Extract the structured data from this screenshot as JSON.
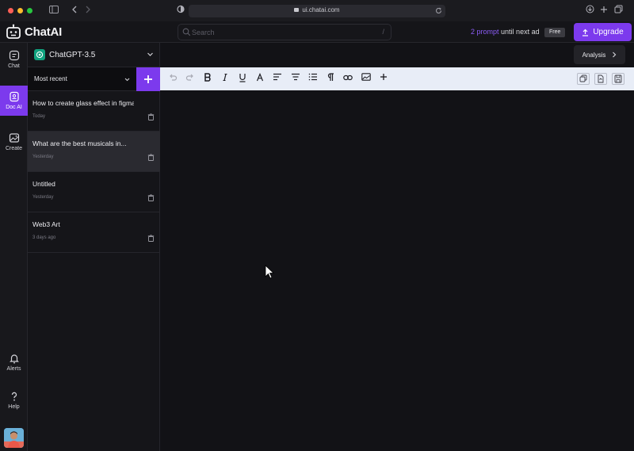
{
  "browser": {
    "url": "ui.chatai.com"
  },
  "app": {
    "name": "ChatAI",
    "search_placeholder": "Search",
    "search_shortcut": "/",
    "prompt_count": "2 prompt",
    "prompt_suffix": "until next ad",
    "plan_badge": "Free",
    "upgrade_label": "Upgrade",
    "accent_color": "#7c3aed"
  },
  "rail": {
    "items": [
      {
        "label": "Chat",
        "icon": "chat-icon"
      },
      {
        "label": "Doc AI",
        "icon": "document-icon",
        "active": true
      },
      {
        "label": "Create",
        "icon": "image-icon"
      }
    ],
    "bottom": [
      {
        "label": "Alerts",
        "icon": "bell-icon"
      },
      {
        "label": "Help",
        "icon": "question-icon"
      }
    ]
  },
  "sidebar": {
    "model": "ChatGPT-3.5",
    "sort": "Most recent",
    "docs": [
      {
        "title": "How to create glass effect in figma",
        "date": "Today"
      },
      {
        "title": "What are the best musicals in...",
        "date": "Yesterday",
        "selected": true
      },
      {
        "title": "Untitled",
        "date": "Yesterday"
      },
      {
        "title": "Web3 Art",
        "date": "3 days ago"
      }
    ]
  },
  "editor": {
    "analysis_label": "Analysis",
    "toolbar": [
      "undo",
      "redo",
      "bold",
      "italic",
      "underline",
      "text-color",
      "align-left",
      "align-center",
      "numbered-list",
      "paragraph",
      "link",
      "image",
      "insert",
      "copy",
      "export",
      "save"
    ]
  }
}
